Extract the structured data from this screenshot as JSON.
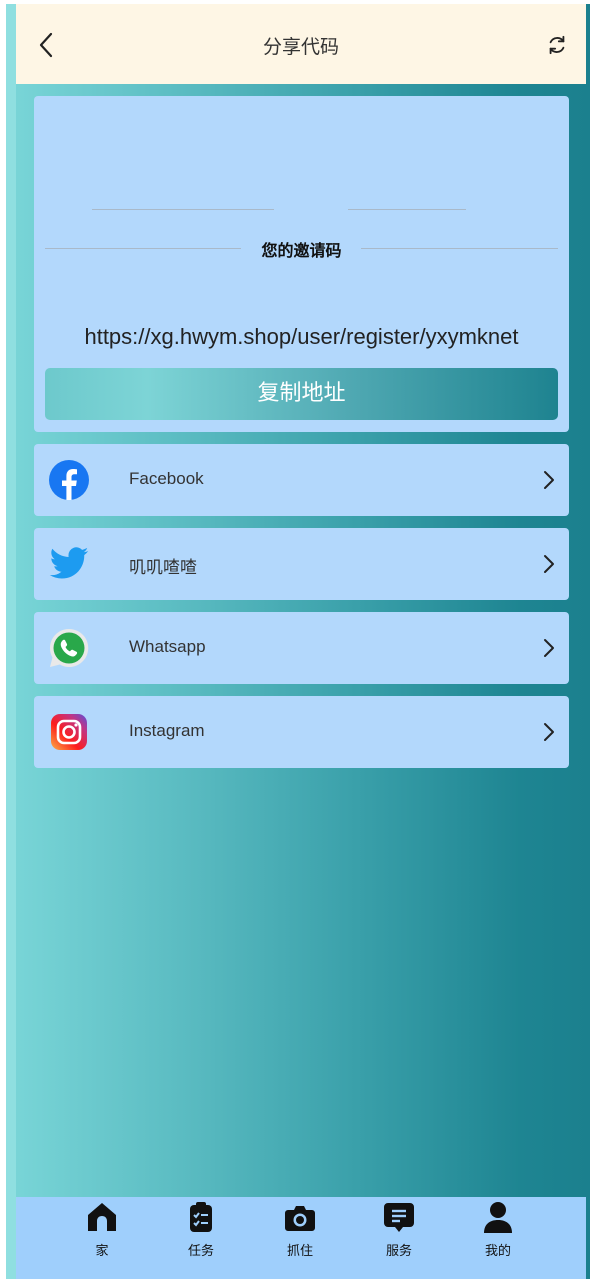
{
  "header": {
    "title": "分享代码",
    "back_icon": "chevron-left-icon",
    "refresh_icon": "refresh-icon"
  },
  "invite": {
    "label": "您的邀请码",
    "url": "https://xg.hwym.shop/user/register/yxymknet",
    "copy_button": "复制地址"
  },
  "share_items": [
    {
      "label": "Facebook",
      "icon": "facebook-icon"
    },
    {
      "label": "叽叽喳喳",
      "icon": "twitter-icon"
    },
    {
      "label": "Whatsapp",
      "icon": "whatsapp-icon"
    },
    {
      "label": "Instagram",
      "icon": "instagram-icon"
    }
  ],
  "tabbar": {
    "items": [
      {
        "label": "家",
        "icon": "home-icon"
      },
      {
        "label": "任务",
        "icon": "task-clipboard-icon"
      },
      {
        "label": "抓住",
        "icon": "camera-icon"
      },
      {
        "label": "服务",
        "icon": "message-icon"
      },
      {
        "label": "我的",
        "icon": "user-icon"
      }
    ]
  },
  "colors": {
    "header_bg": "#fef6e5",
    "card_bg": "#b3d8fc",
    "tabbar_bg": "#9fcffc",
    "gradient_start": "#7ad6d8",
    "gradient_end": "#1b808e"
  }
}
